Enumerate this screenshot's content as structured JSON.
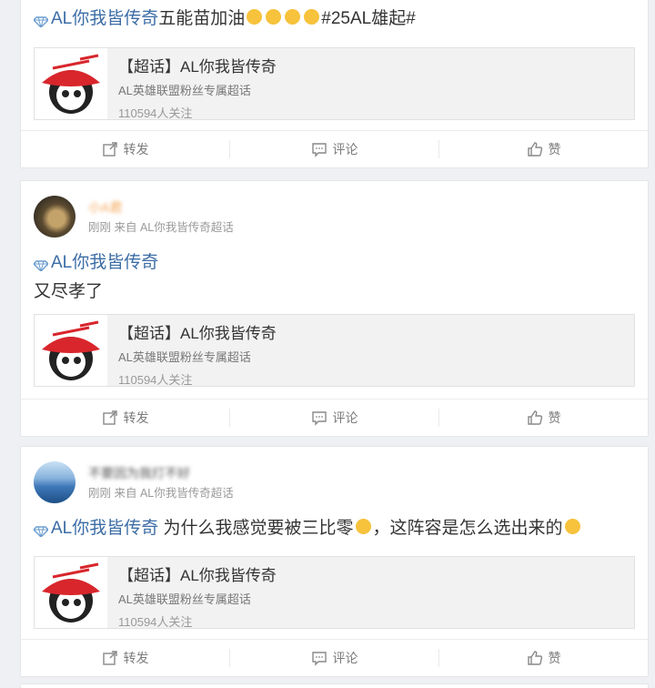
{
  "posts": [
    {
      "id": "p1",
      "show_user": false,
      "text_prefix": "AL你我皆传奇",
      "text_rest": "五能苗加油",
      "emoji_count": 4,
      "text_hashtag": "#25AL雄起#",
      "super_card": {
        "title": "【超话】AL你我皆传奇",
        "desc": "AL英雄联盟粉丝专属超话",
        "fans": "110594人关注"
      },
      "actions": {
        "repost": "转发",
        "comment": "评论",
        "like": "赞"
      }
    },
    {
      "id": "p2",
      "show_user": true,
      "user_name": "小A君",
      "user_source": "刚刚 来自 AL你我皆传奇超话",
      "text_prefix": "AL你我皆传奇",
      "text_second": "又尽孝了",
      "super_card": {
        "title": "【超话】AL你我皆传奇",
        "desc": "AL英雄联盟粉丝专属超话",
        "fans": "110594人关注"
      },
      "actions": {
        "repost": "转发",
        "comment": "评论",
        "like": "赞"
      }
    },
    {
      "id": "p3",
      "show_user": true,
      "user_name": "不要因为我打不好",
      "user_source": "刚刚 来自 AL你我皆传奇超话",
      "text_prefix": "AL你我皆传奇",
      "text_rest_a": " 为什么我感觉要被三比零",
      "text_rest_b": "，这阵容是怎么选出来的",
      "super_card": {
        "title": "【超话】AL你我皆传奇",
        "desc": "AL英雄联盟粉丝专属超话",
        "fans": "110594人关注"
      },
      "actions": {
        "repost": "转发",
        "comment": "评论",
        "like": "赞"
      }
    }
  ],
  "colors": {
    "topic": "#3c6da6",
    "text": "#333333",
    "meta": "#9a9a9a",
    "background": "#eef0f3",
    "card": "#ffffff"
  }
}
